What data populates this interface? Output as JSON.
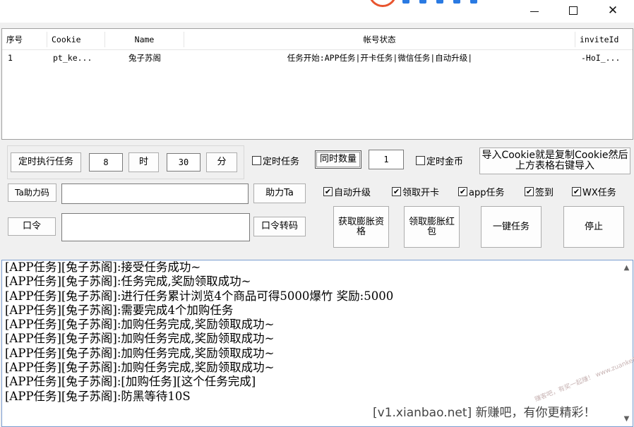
{
  "window": {
    "minimize_glyph": "–",
    "maximize_glyph": "☐",
    "close_glyph": "✕"
  },
  "table": {
    "headers": [
      "序号",
      "Cookie",
      "Name",
      "帐号状态",
      "inviteId"
    ],
    "rows": [
      [
        "1",
        "pt_ke...",
        "兔子苏阁",
        "任务开始:APP任务|开卡任务|微信任务|自动升级|",
        "-HoI_..."
      ]
    ]
  },
  "timer": {
    "run_button": "定时执行任务",
    "hour_value": "8",
    "hour_button": "时",
    "minute_value": "30",
    "minute_button": "分",
    "timed_task_label": "定时任务",
    "concurrency_button": "同时数量",
    "concurrency_value": "1",
    "timed_gold_label": "定时金币",
    "import_button": "导入Cookie就是复制Cookie然后上方表格右键导入"
  },
  "assist": {
    "help_code_button": "Ta助力码",
    "help_code_value": "",
    "help_button": "助力Ta"
  },
  "command": {
    "cmd_button": "口令",
    "cmd_value": "",
    "convert_button": "口令转码"
  },
  "options": [
    {
      "label": "自动升级",
      "checked": true
    },
    {
      "label": "领取开卡",
      "checked": true
    },
    {
      "label": "app任务",
      "checked": true
    },
    {
      "label": "签到",
      "checked": true
    },
    {
      "label": "WX任务",
      "checked": true
    }
  ],
  "actions": {
    "get_qualification": "获取膨胀资格",
    "claim_redpacket": "领取膨胀红包",
    "one_click": "一键任务",
    "stop": "停止"
  },
  "log": [
    "[APP任务][兔子苏阁]:接受任务成功~",
    "[APP任务][兔子苏阁]:任务完成,奖励领取成功~",
    "[APP任务][兔子苏阁]:进行任务累计浏览4个商品可得5000爆竹 奖励:5000",
    "[APP任务][兔子苏阁]:需要完成4个加购任务",
    "[APP任务][兔子苏阁]:加购任务完成,奖励领取成功~",
    "[APP任务][兔子苏阁]:加购任务完成,奖励领取成功~",
    "[APP任务][兔子苏阁]:加购任务完成,奖励领取成功~",
    "[APP任务][兔子苏阁]:加购任务完成,奖励领取成功~",
    "[APP任务][兔子苏阁]:[加购任务][这个任务完成]",
    "[APP任务][兔子苏阁]:防黑等待10S"
  ],
  "watermark": "[v1.xianbao.net] 新赚吧，有你更精彩！",
  "stamp_text": "赚客吧，有奖一起赚！ www.zuanke8.com"
}
